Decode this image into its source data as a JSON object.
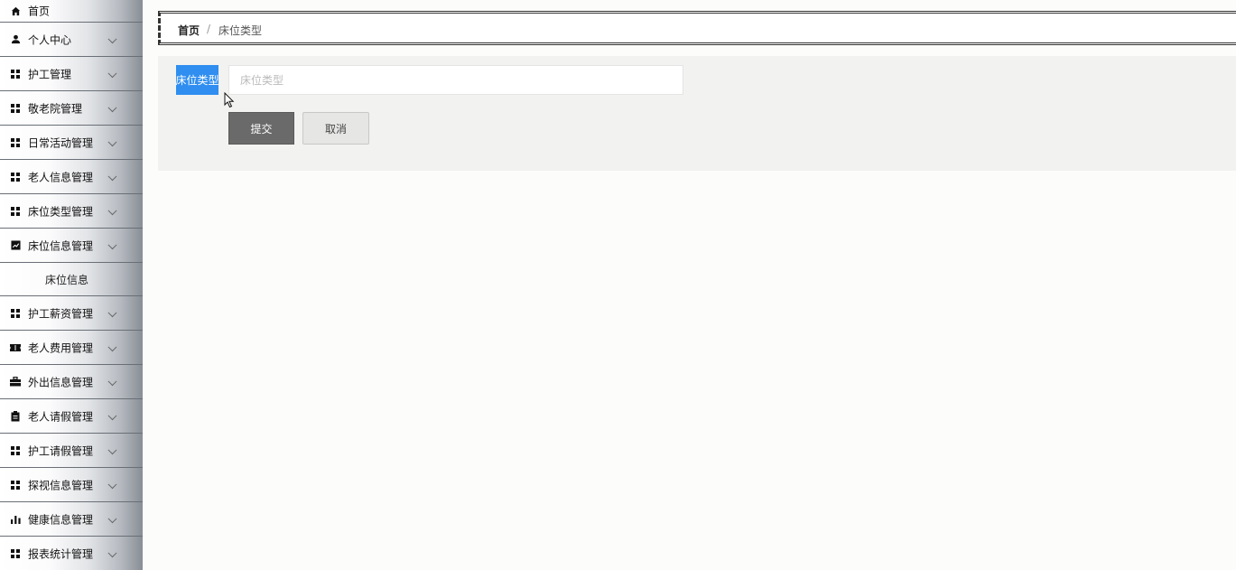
{
  "sidebar": {
    "items": [
      {
        "label": "首页",
        "icon": "home-icon"
      },
      {
        "label": "个人中心",
        "icon": "user-icon"
      },
      {
        "label": "护工管理",
        "icon": "grid-icon"
      },
      {
        "label": "敬老院管理",
        "icon": "grid-icon"
      },
      {
        "label": "日常活动管理",
        "icon": "grid-icon"
      },
      {
        "label": "老人信息管理",
        "icon": "grid-icon"
      },
      {
        "label": "床位类型管理",
        "icon": "grid-icon"
      },
      {
        "label": "床位信息管理",
        "icon": "chart-icon"
      },
      {
        "label": "护工薪资管理",
        "icon": "grid-icon"
      },
      {
        "label": "老人费用管理",
        "icon": "ticket-icon"
      },
      {
        "label": "外出信息管理",
        "icon": "briefcase-icon"
      },
      {
        "label": "老人请假管理",
        "icon": "clipboard-icon"
      },
      {
        "label": "护工请假管理",
        "icon": "grid-icon"
      },
      {
        "label": "探视信息管理",
        "icon": "grid-icon"
      },
      {
        "label": "健康信息管理",
        "icon": "bar-chart-icon"
      },
      {
        "label": "报表统计管理",
        "icon": "grid-icon"
      }
    ],
    "sub_item": "床位信息"
  },
  "breadcrumb": {
    "home": "首页",
    "separator": "/",
    "current": "床位类型"
  },
  "form": {
    "label": "床位类型",
    "placeholder": "床位类型",
    "value": "",
    "submit_label": "提交",
    "cancel_label": "取消"
  },
  "colors": {
    "label_bg": "#2f8ef0",
    "submit_bg": "#6a6a6a",
    "cancel_bg": "#e6e6e5",
    "panel_bg": "#f2f2f1"
  }
}
